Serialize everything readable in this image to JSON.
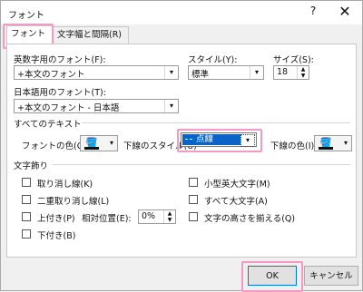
{
  "window": {
    "title": "フォント",
    "help": "?",
    "close": "✕"
  },
  "tabs": [
    {
      "label": "フォント(N)"
    },
    {
      "label": "文字幅と間隔(R)"
    }
  ],
  "western_font": {
    "label": "英数字用のフォント(F):",
    "value": "+本文のフォント"
  },
  "style": {
    "label": "スタイル(Y):",
    "value": "標準"
  },
  "size": {
    "label": "サイズ(S):",
    "value": "18"
  },
  "japanese_font": {
    "label": "日本語用のフォント(T):",
    "value": "+本文のフォント - 日本語"
  },
  "all_text": {
    "section": "すべてのテキスト",
    "font_color_label": "フォントの色(C)",
    "underline_style_label": "下線のスタイル(U)",
    "underline_style_value": "点線",
    "underline_color_label": "下線の色(I)"
  },
  "effects": {
    "section": "文字飾り",
    "strikethrough": "取り消し線(K)",
    "double_strikethrough": "二重取り消し線(L)",
    "superscript": "上付き(P)",
    "offset_label": "相対位置(E):",
    "offset_value": "0%",
    "subscript": "下付き(B)",
    "small_caps": "小型英大文字(M)",
    "all_caps": "すべて大文字(A)",
    "equalize_height": "文字の高さを揃える(Q)"
  },
  "buttons": {
    "ok": "OK",
    "cancel": "キャンセル"
  },
  "colors": {
    "highlight": "#f29ac5",
    "selection": "#0a64c8",
    "font_color_bar": "#111111",
    "underline_color_bar": "#111111"
  },
  "icons": {
    "dropdown": "▾",
    "paint_bucket": "🪣"
  }
}
